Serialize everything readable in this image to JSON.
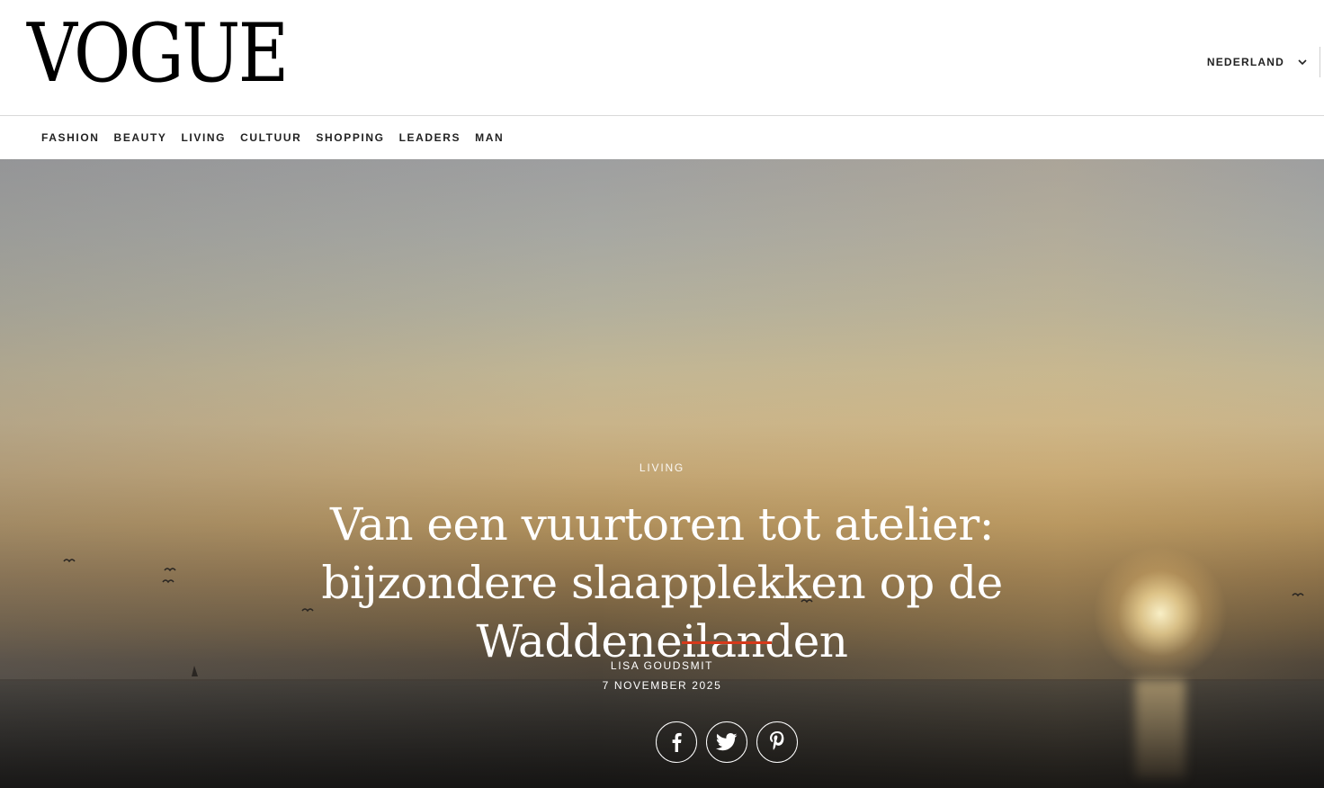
{
  "header": {
    "logo": "VOGUE",
    "region": {
      "label": "NEDERLAND",
      "icon": "chevron-down-icon"
    }
  },
  "nav": {
    "items": [
      {
        "label": "FASHION"
      },
      {
        "label": "BEAUTY"
      },
      {
        "label": "LIVING"
      },
      {
        "label": "CULTUUR"
      },
      {
        "label": "SHOPPING"
      },
      {
        "label": "LEADERS"
      },
      {
        "label": "MAN"
      }
    ]
  },
  "hero": {
    "image": "sunset-over-sea-with-birds",
    "category": "LIVING",
    "headline": "Van een vuurtoren tot atelier: bijzondere slaapplekken op de Waddeneilanden",
    "author": "LISA GOUDSMIT",
    "date": "7 NOVEMBER 2025",
    "accent_color": "#d6391b",
    "share": [
      {
        "icon": "facebook-icon"
      },
      {
        "icon": "twitter-icon"
      },
      {
        "icon": "pinterest-icon"
      }
    ]
  }
}
